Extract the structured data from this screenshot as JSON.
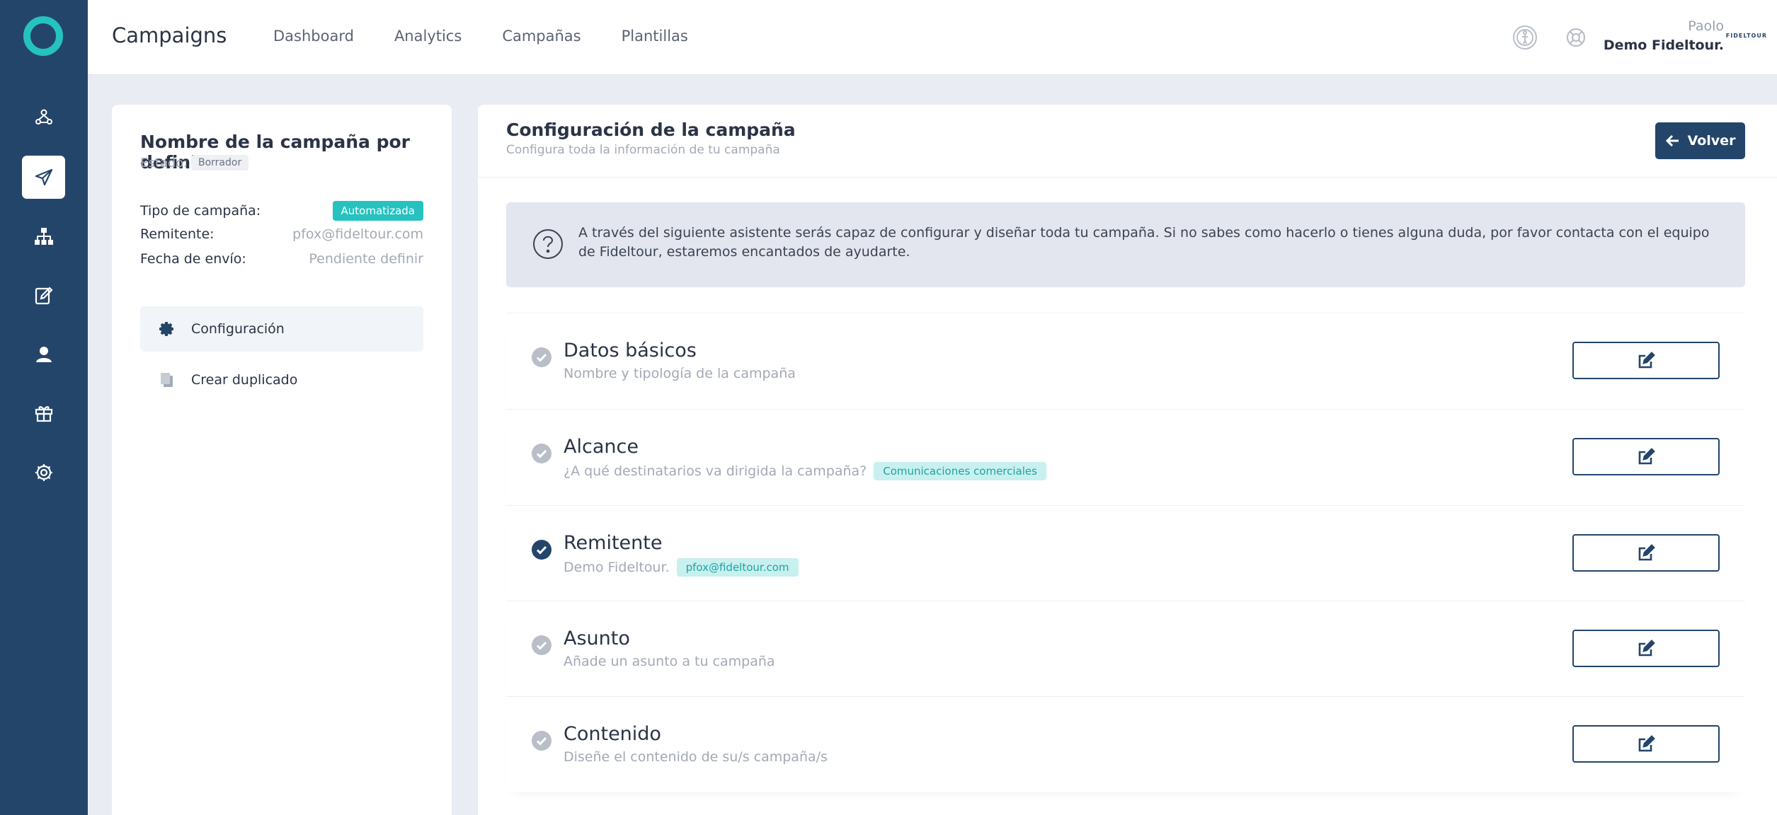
{
  "app": {
    "title": "Campaigns"
  },
  "topnav": {
    "items": [
      "Dashboard",
      "Analytics",
      "Campañas",
      "Plantillas"
    ]
  },
  "user": {
    "name": "Paolo",
    "company": "Demo Fideltour.",
    "brand": "FIDELTOUR"
  },
  "sidebar": {
    "icons": [
      "users-network-icon",
      "paper-plane-icon",
      "sitemap-icon",
      "edit-form-icon",
      "user-icon",
      "gift-icon",
      "gear-icon"
    ],
    "active": "paper-plane-icon"
  },
  "campaign": {
    "name": "Nombre de la campaña por definir",
    "status_label": "Estado:",
    "status_value": "Borrador",
    "rows": [
      {
        "key": "Tipo de campaña:",
        "value": "Automatizada"
      },
      {
        "key": "Remitente:",
        "value": "pfox@fideltour.com"
      },
      {
        "key": "Fecha de envío:",
        "value": "Pendiente definir"
      }
    ],
    "menu": [
      {
        "label": "Configuración",
        "icon": "gear-icon"
      },
      {
        "label": "Crear duplicado",
        "icon": "copy-icon"
      }
    ]
  },
  "config": {
    "title": "Configuración de la campaña",
    "subtitle": "Configura toda la información de tu campaña",
    "back_label": "Volver",
    "help_text": "A través del siguiente asistente serás capaz de configurar y diseñar toda tu campaña. Si no sabes como hacerlo o tienes alguna duda, por favor contacta con el equipo de Fideltour, estaremos encantados de ayudarte.",
    "steps": [
      {
        "title": "Datos básicos",
        "subtitle": "Nombre y tipología de la campaña",
        "tag": "",
        "completed": false
      },
      {
        "title": "Alcance",
        "subtitle": "¿A qué destinatarios va dirigida la campaña?",
        "tag": "Comunicaciones comerciales",
        "completed": false
      },
      {
        "title": "Remitente",
        "subtitle": "Demo Fideltour.",
        "tag": "pfox@fideltour.com",
        "completed": true
      },
      {
        "title": "Asunto",
        "subtitle": "Añade un asunto a tu campaña",
        "tag": "",
        "completed": false
      },
      {
        "title": "Contenido",
        "subtitle": "Diseñe el contenido de su/s campaña/s",
        "tag": "",
        "completed": false
      }
    ]
  },
  "colors": {
    "sidebar": "#24456a",
    "accent": "#25c2c0",
    "check_pending": "#b9bec8",
    "check_done": "#24456a"
  }
}
